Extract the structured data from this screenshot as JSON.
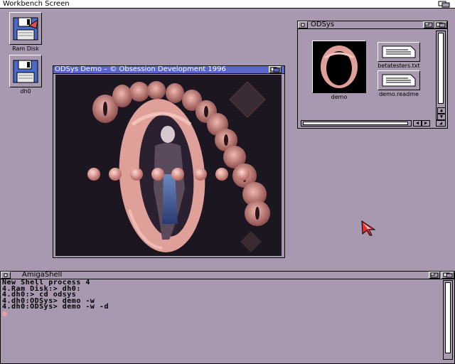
{
  "screen": {
    "title": "Workbench Screen"
  },
  "desktop_icons": [
    {
      "label": "Ram Disk",
      "icon": "floppy-disk-icon"
    },
    {
      "label": "dh0",
      "icon": "floppy-disk-icon"
    }
  ],
  "odsys_window": {
    "title": "ODSys",
    "items": [
      {
        "label": "demo",
        "icon": "demo-tool-icon"
      },
      {
        "label": "betatesters.txt",
        "icon": "text-document-icon"
      },
      {
        "label": "demo.readme",
        "icon": "text-document-icon"
      }
    ]
  },
  "demo_window": {
    "title": "ODSys Demo – © Obsession Development 1996"
  },
  "shell_window": {
    "title": "AmigaShell",
    "lines": [
      "New Shell process 4",
      "4.Ram Disk:> dh0:",
      "4.dh0:> cd odsys",
      "4.dh0:ODSys> demo -w",
      "4.dh0:ODSys> demo -w -d"
    ]
  },
  "colors": {
    "workbench_bg": "#a898b0",
    "active_title": "#5a66c8",
    "demo_bg": "#1c1620",
    "ring_pink": "#e0a09a"
  }
}
